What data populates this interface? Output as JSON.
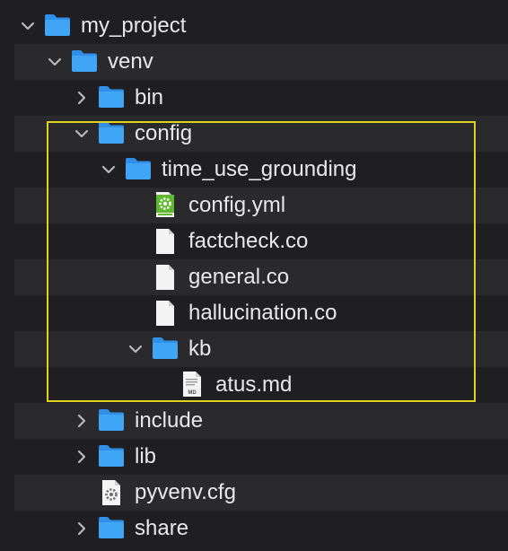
{
  "tree": {
    "items": [
      {
        "label": "my_project",
        "type": "folder",
        "expanded": true
      },
      {
        "label": "venv",
        "type": "folder",
        "expanded": true
      },
      {
        "label": "bin",
        "type": "folder",
        "expanded": false
      },
      {
        "label": "config",
        "type": "folder",
        "expanded": true
      },
      {
        "label": "time_use_grounding",
        "type": "folder",
        "expanded": true
      },
      {
        "label": "config.yml",
        "type": "file",
        "icon": "yaml-gear-icon"
      },
      {
        "label": "factcheck.co",
        "type": "file",
        "icon": "document-icon"
      },
      {
        "label": "general.co",
        "type": "file",
        "icon": "document-icon"
      },
      {
        "label": "hallucination.co",
        "type": "file",
        "icon": "document-icon"
      },
      {
        "label": "kb",
        "type": "folder",
        "expanded": true
      },
      {
        "label": "atus.md",
        "type": "file",
        "icon": "markdown-file-icon",
        "badge": "MD"
      },
      {
        "label": "include",
        "type": "folder",
        "expanded": false
      },
      {
        "label": "lib",
        "type": "folder",
        "expanded": false
      },
      {
        "label": "pyvenv.cfg",
        "type": "file",
        "icon": "settings-file-icon"
      },
      {
        "label": "share",
        "type": "folder",
        "expanded": false
      }
    ]
  },
  "colors": {
    "background": "#1f1f21",
    "row_stripe": "#2a2a2c",
    "folder_blue": "#3fa2f5",
    "highlight_border": "#e0d31f",
    "text": "#e8e8ea",
    "yaml_green": "#5fb82e"
  }
}
